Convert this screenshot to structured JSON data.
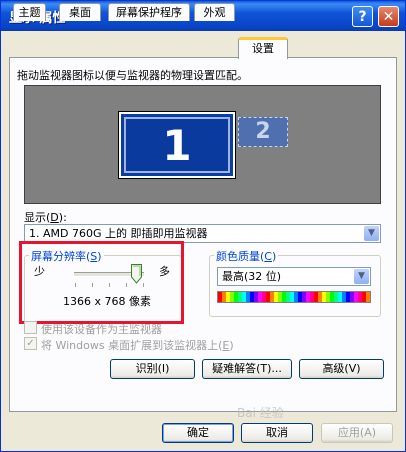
{
  "window": {
    "title": "显示 属性",
    "help_glyph": "?",
    "close_glyph": "✕"
  },
  "tabs": [
    {
      "label": "主题"
    },
    {
      "label": "桌面"
    },
    {
      "label": "屏幕保护程序"
    },
    {
      "label": "外观"
    },
    {
      "label": "设置",
      "active": true
    }
  ],
  "description": "拖动监视器图标以便与监视器的物理设置匹配。",
  "monitors": [
    {
      "number": "1",
      "primary": true
    },
    {
      "number": "2",
      "primary": false
    }
  ],
  "display": {
    "label": "显示",
    "accel": "D",
    "value": "1. AMD 760G 上的 即插即用监视器"
  },
  "resolution": {
    "title": "屏幕分辨率",
    "accel": "S",
    "less": "少",
    "more": "多",
    "value_text": "1366 x 768 像素"
  },
  "color_quality": {
    "title": "颜色质量",
    "accel": "C",
    "value": "最高(32 位)"
  },
  "checkboxes": [
    {
      "label": "使用该设备作为主监视器",
      "checked": false
    },
    {
      "label": "将 Windows 桌面扩展到该监视器上",
      "accel": "E",
      "checked": true
    }
  ],
  "buttons": {
    "identify": "识别(I)",
    "troubleshoot": "疑难解答(T)...",
    "advanced": "高级(V)",
    "ok": "确定",
    "cancel": "取消",
    "apply": "应用(A)"
  },
  "colors": {
    "highlight_box": "#e8142d",
    "title_bar": "#0843c4",
    "group_title": "#0046d5"
  },
  "watermark": "Bai 经验"
}
